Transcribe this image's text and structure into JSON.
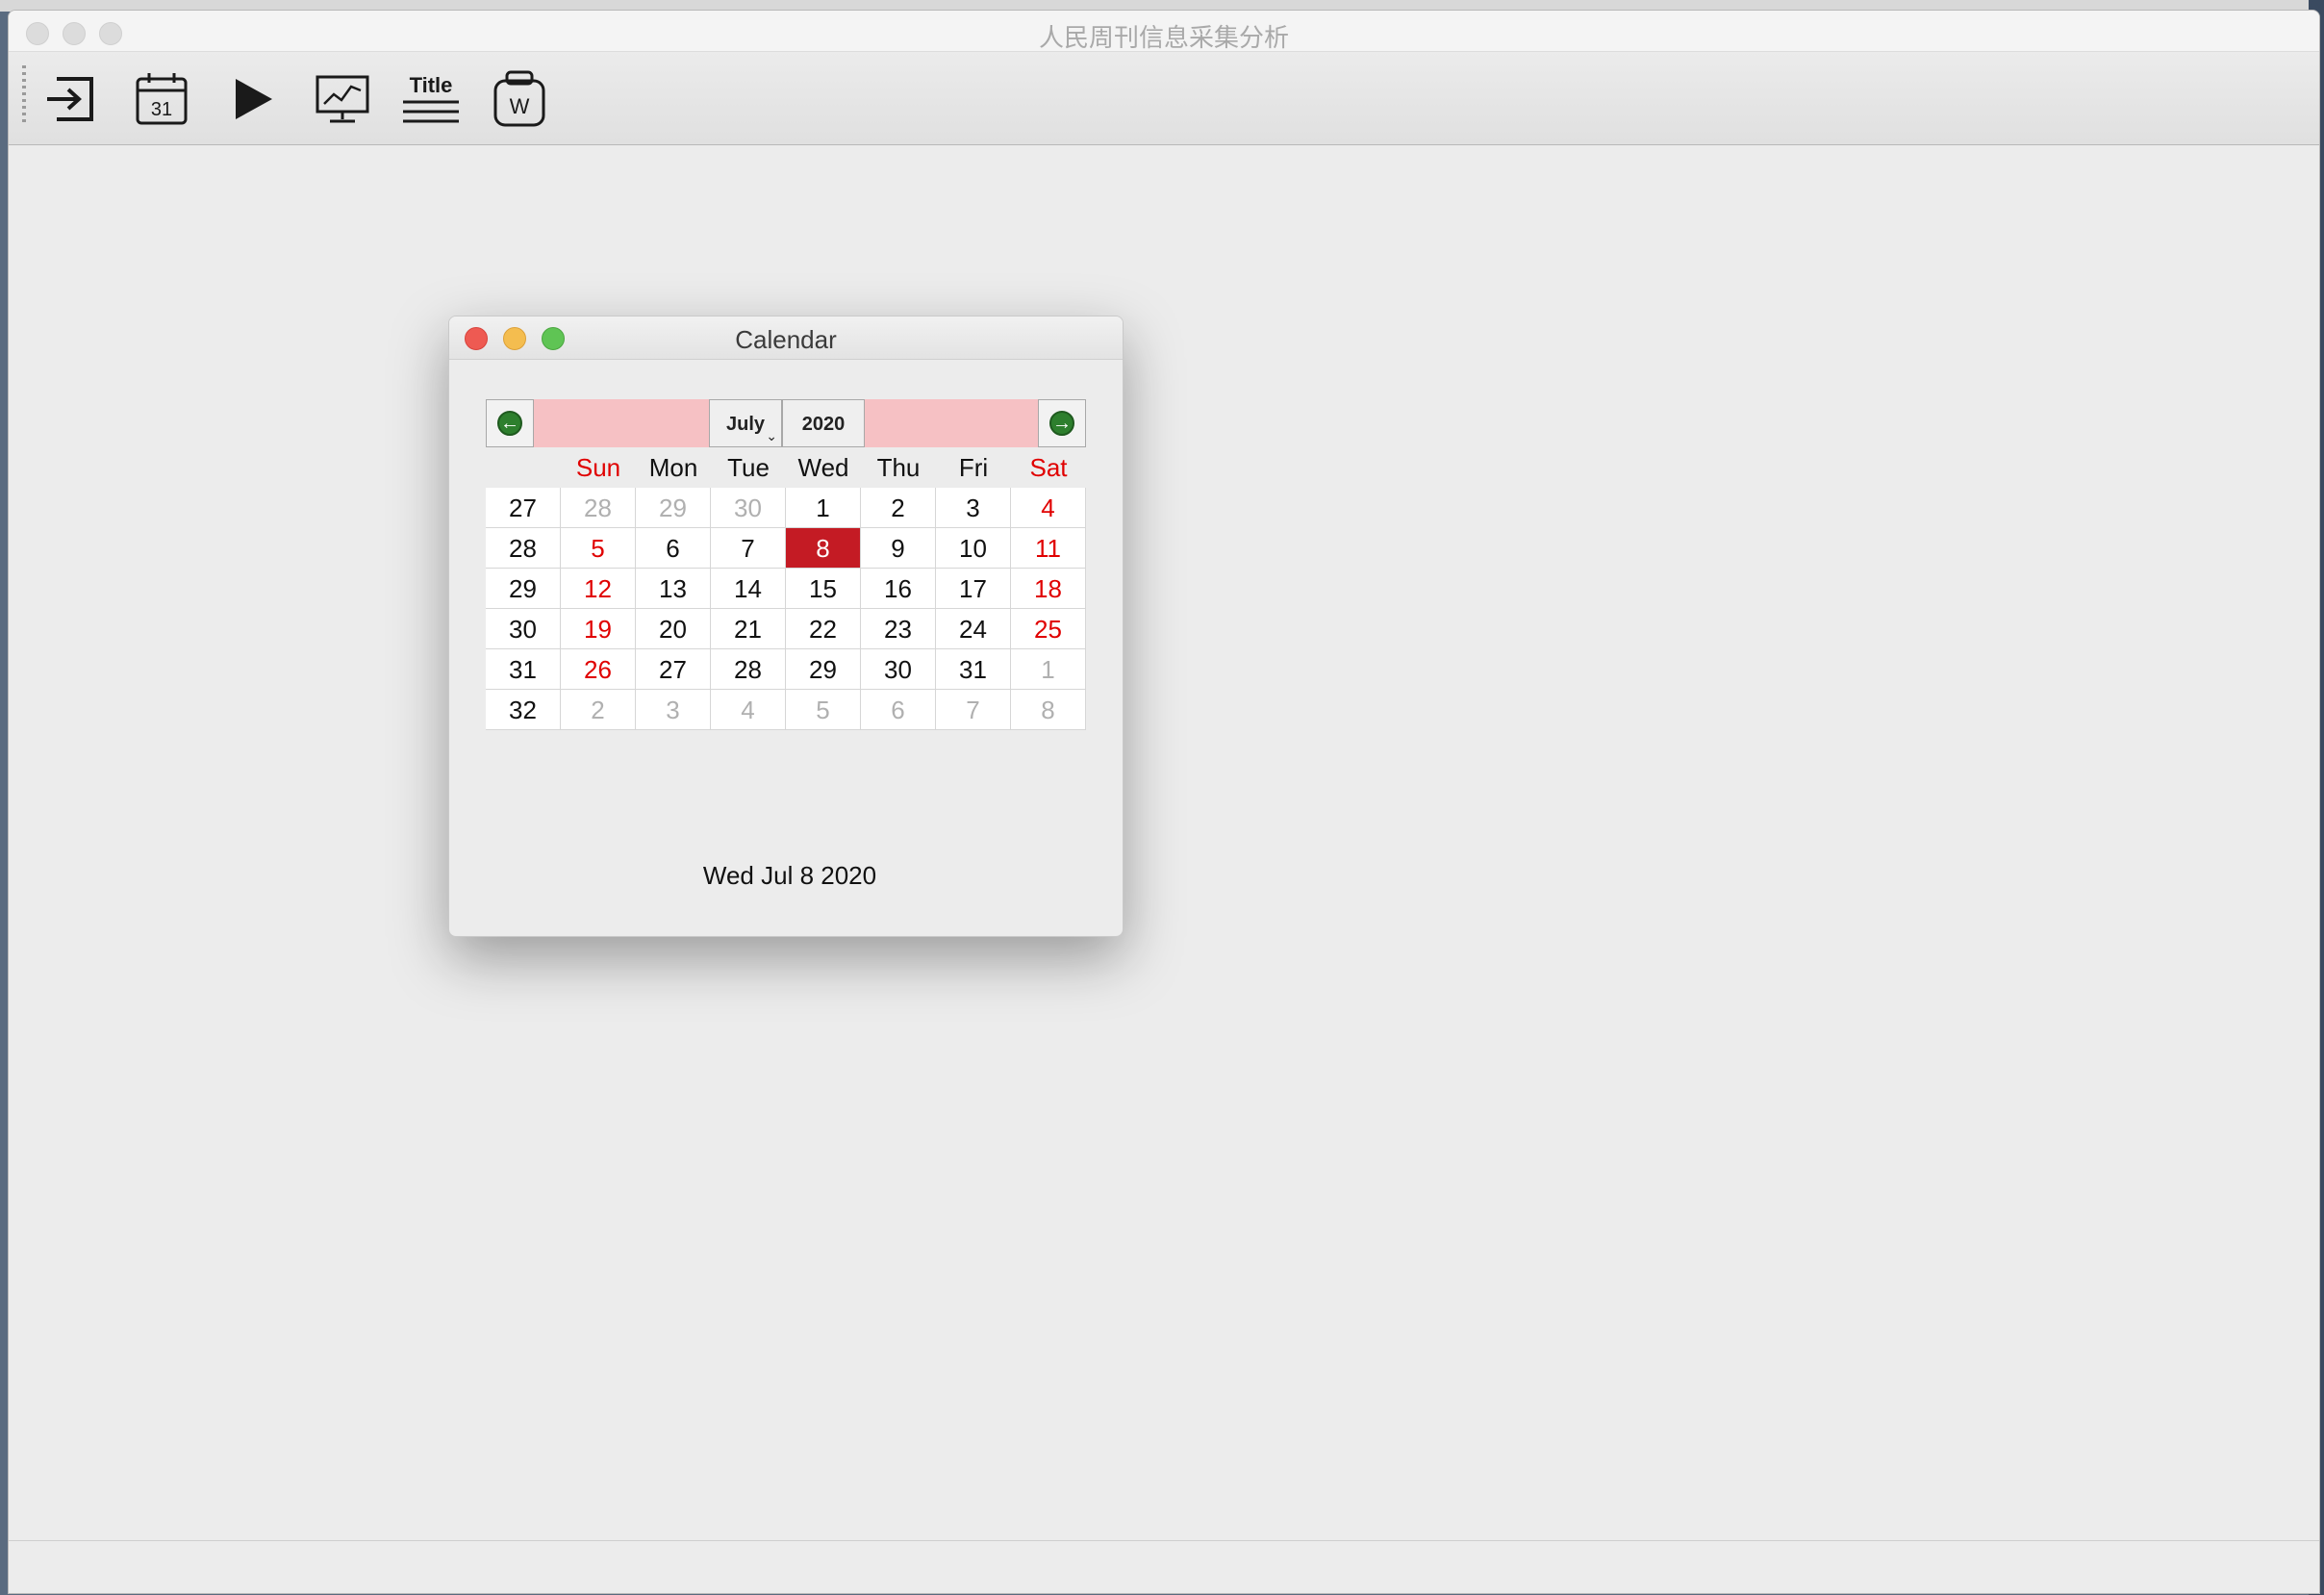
{
  "main_window": {
    "title": "人民周刊信息采集分析",
    "toolbar": {
      "buttons": [
        {
          "name": "import-icon"
        },
        {
          "name": "calendar-icon",
          "label": "31"
        },
        {
          "name": "play-icon"
        },
        {
          "name": "chart-monitor-icon"
        },
        {
          "name": "title-icon",
          "label": "Title"
        },
        {
          "name": "word-export-icon",
          "label": "W"
        }
      ]
    }
  },
  "calendar_dialog": {
    "title": "Calendar",
    "month": "July",
    "year": "2020",
    "prev_icon": "arrow-left-circle",
    "next_icon": "arrow-right-circle",
    "weekdays": [
      "Sun",
      "Mon",
      "Tue",
      "Wed",
      "Thu",
      "Fri",
      "Sat"
    ],
    "weeks": [
      {
        "week": "27",
        "days": [
          "28",
          "29",
          "30",
          "1",
          "2",
          "3",
          "4"
        ]
      },
      {
        "week": "28",
        "days": [
          "5",
          "6",
          "7",
          "8",
          "9",
          "10",
          "11"
        ]
      },
      {
        "week": "29",
        "days": [
          "12",
          "13",
          "14",
          "15",
          "16",
          "17",
          "18"
        ]
      },
      {
        "week": "30",
        "days": [
          "19",
          "20",
          "21",
          "22",
          "23",
          "24",
          "25"
        ]
      },
      {
        "week": "31",
        "days": [
          "26",
          "27",
          "28",
          "29",
          "30",
          "31",
          "1"
        ]
      },
      {
        "week": "32",
        "days": [
          "2",
          "3",
          "4",
          "5",
          "6",
          "7",
          "8"
        ]
      }
    ],
    "selected_date": "8",
    "selected_label": "Wed Jul 8 2020"
  },
  "colors": {
    "weekend": "#e00000",
    "selected": "#c41b24",
    "nav_bar": "#f6c1c4",
    "other_month": "#b0b0b0"
  }
}
